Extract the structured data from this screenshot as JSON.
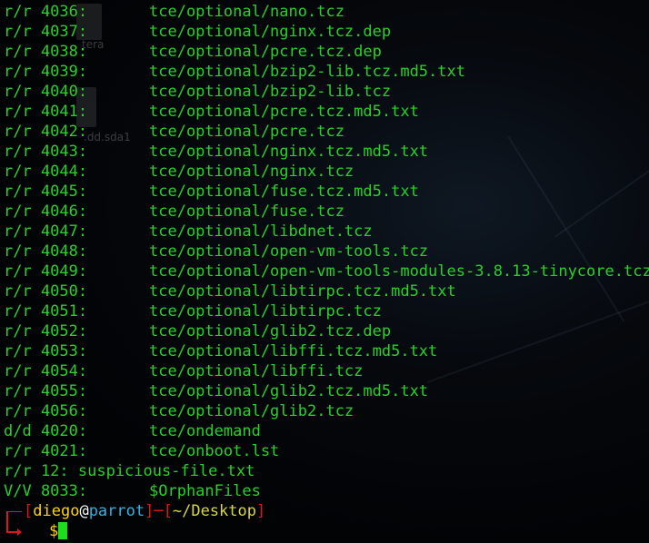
{
  "desktop": {
    "icon_label_1": "tera",
    "icon_label_2": ".dd.sda1"
  },
  "listing": [
    {
      "id": "r/r 4036:",
      "path": "tce/optional/nano.tcz"
    },
    {
      "id": "r/r 4037:",
      "path": "tce/optional/nginx.tcz.dep"
    },
    {
      "id": "r/r 4038:",
      "path": "tce/optional/pcre.tcz.dep"
    },
    {
      "id": "r/r 4039:",
      "path": "tce/optional/bzip2-lib.tcz.md5.txt"
    },
    {
      "id": "r/r 4040:",
      "path": "tce/optional/bzip2-lib.tcz"
    },
    {
      "id": "r/r 4041:",
      "path": "tce/optional/pcre.tcz.md5.txt"
    },
    {
      "id": "r/r 4042:",
      "path": "tce/optional/pcre.tcz"
    },
    {
      "id": "r/r 4043:",
      "path": "tce/optional/nginx.tcz.md5.txt"
    },
    {
      "id": "r/r 4044:",
      "path": "tce/optional/nginx.tcz"
    },
    {
      "id": "r/r 4045:",
      "path": "tce/optional/fuse.tcz.md5.txt"
    },
    {
      "id": "r/r 4046:",
      "path": "tce/optional/fuse.tcz"
    },
    {
      "id": "r/r 4047:",
      "path": "tce/optional/libdnet.tcz"
    },
    {
      "id": "r/r 4048:",
      "path": "tce/optional/open-vm-tools.tcz"
    },
    {
      "id": "r/r 4049:",
      "path": "tce/optional/open-vm-tools-modules-3.8.13-tinycore.tcz"
    },
    {
      "id": "r/r 4050:",
      "path": "tce/optional/libtirpc.tcz.md5.txt"
    },
    {
      "id": "r/r 4051:",
      "path": "tce/optional/libtirpc.tcz"
    },
    {
      "id": "r/r 4052:",
      "path": "tce/optional/glib2.tcz.dep"
    },
    {
      "id": "r/r 4053:",
      "path": "tce/optional/libffi.tcz.md5.txt"
    },
    {
      "id": "r/r 4054:",
      "path": "tce/optional/libffi.tcz"
    },
    {
      "id": "r/r 4055:",
      "path": "tce/optional/glib2.tcz.md5.txt"
    },
    {
      "id": "r/r 4056:",
      "path": "tce/optional/glib2.tcz"
    },
    {
      "id": "d/d 4020:",
      "path": "tce/ondemand"
    },
    {
      "id": "r/r 4021:",
      "path": "tce/onboot.lst"
    }
  ],
  "suspicious_line": "r/r 12: suspicious-file.txt",
  "orphan": {
    "id": "V/V 8033:",
    "path": "$OrphanFiles"
  },
  "prompt": {
    "open_bracket": "[",
    "user": "diego",
    "at": "@",
    "host": "parrot",
    "close_bracket": "]",
    "separator": "─",
    "dir_open": "[",
    "cwd": "~/Desktop",
    "dir_close": "]",
    "symbol": "$"
  },
  "colors": {
    "text": "#27d127",
    "prompt_frame": "#d8191f",
    "user": "#ffd300",
    "host": "#2eb3e6",
    "cwd": "#d8d63c",
    "cursor": "#1edc1e"
  }
}
